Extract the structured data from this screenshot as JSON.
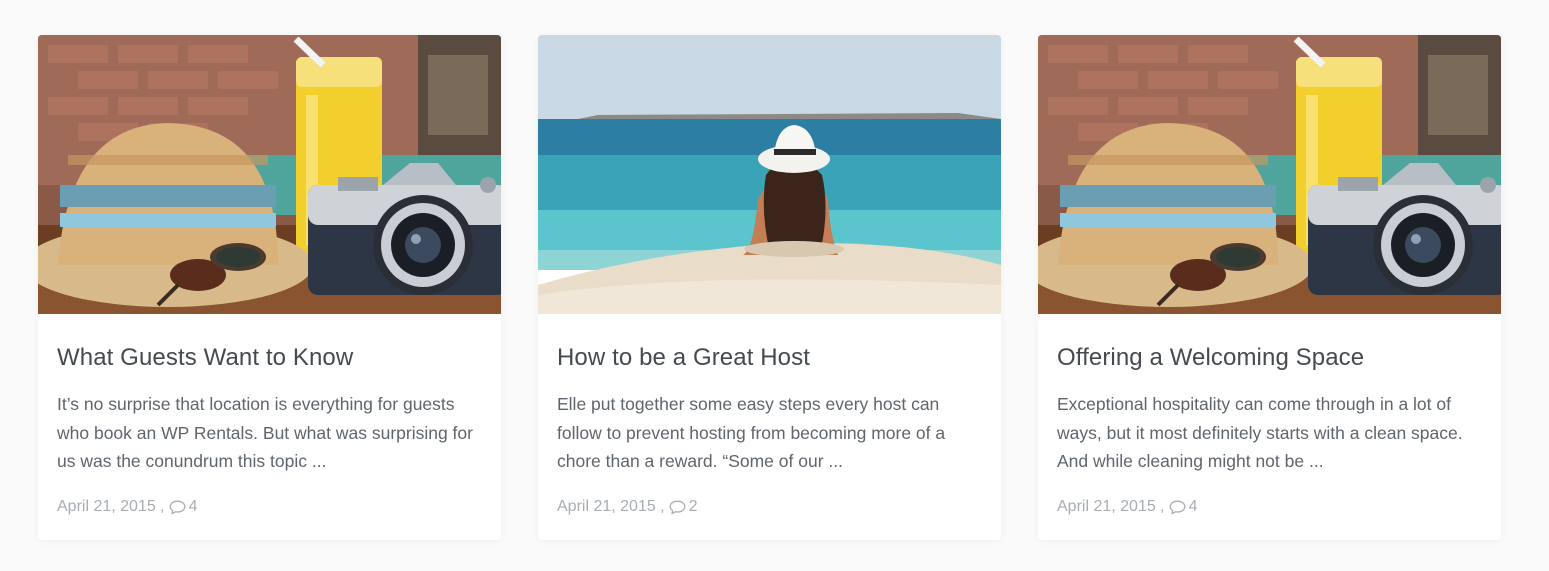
{
  "posts": [
    {
      "title": "What Guests Want to Know",
      "excerpt": "It’s no surprise that location is everything for guests who book an WP Rentals. But what was surprising for us was the conundrum this topic ...",
      "date": "April 21, 2015 ,",
      "comments": "4",
      "image": "beach-table-hat-camera-juice"
    },
    {
      "title": "How to be a Great Host",
      "excerpt": "Elle put together some easy steps every host can follow to prevent hosting from becoming more of a chore than a reward. “Some of our ...",
      "date": "April 21, 2015 ,",
      "comments": "2",
      "image": "woman-in-hat-at-sea"
    },
    {
      "title": "Offering a Welcoming Space",
      "excerpt": "Exceptional hospitality can come through in a lot of ways, but it most definitely starts with a clean space. And while cleaning might not be ...",
      "date": "April 21, 2015 ,",
      "comments": "4",
      "image": "beach-table-hat-camera-juice"
    }
  ],
  "colors": {
    "page_background": "#fafafb",
    "card_background": "#ffffff",
    "title": "#454a50",
    "excerpt": "#5f656c",
    "meta": "#a8adb3"
  }
}
